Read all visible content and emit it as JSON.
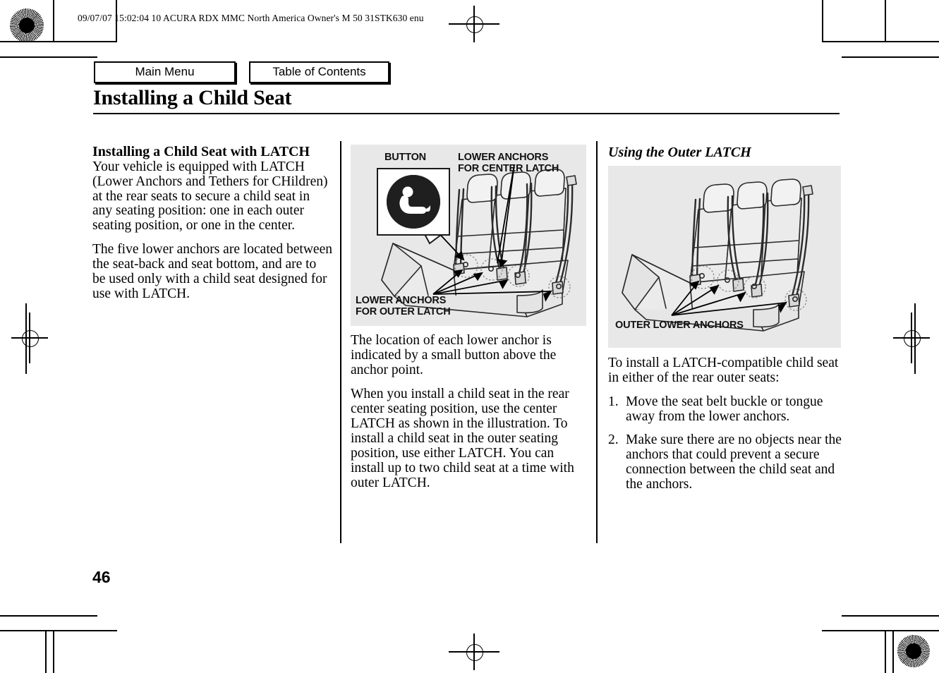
{
  "header": {
    "print_info": "09/07/07 15:02:04    10 ACURA RDX MMC North America Owner's M 50 31STK630 enu"
  },
  "nav": {
    "main_menu": "Main Menu",
    "table_of_contents": "Table of Contents"
  },
  "page": {
    "title": "Installing a Child Seat",
    "number": "46"
  },
  "left_column": {
    "heading": "Installing a Child Seat with LATCH",
    "paragraph_1": "Your vehicle is equipped with LATCH (Lower Anchors and Tethers for CHildren) at the rear seats to secure a child seat in any seating position: one in each outer seating position, or one in the center.",
    "paragraph_2": "The five lower anchors are located between the seat-back and seat bottom, and are to be used only with a child seat designed for use with LATCH."
  },
  "middle_column": {
    "figure": {
      "label_button": "BUTTON",
      "label_center_latch": "LOWER ANCHORS\nFOR CENTER LATCH",
      "label_outer_latch": "LOWER ANCHORS\nFOR OUTER LATCH",
      "pictogram_name": "child-seat-symbol"
    },
    "paragraph_1": "The location of each lower anchor is indicated by a small button above the anchor point.",
    "paragraph_2": "When you install a child seat in the rear center seating position, use the center LATCH as shown in the illustration. To install a child seat in the outer seating position, use either LATCH. You can install up to two child seat at a time with outer LATCH."
  },
  "right_column": {
    "heading": "Using the Outer LATCH",
    "figure": {
      "label_outer_anchors": "OUTER LOWER ANCHORS"
    },
    "intro": "To install a LATCH-compatible child seat in either of the rear outer seats:",
    "steps": [
      {
        "number": "1.",
        "text": "Move the seat belt buckle or tongue away from the lower anchors."
      },
      {
        "number": "2.",
        "text": "Make sure there are no objects near the anchors that could prevent a secure connection between the child seat and the anchors."
      }
    ]
  }
}
